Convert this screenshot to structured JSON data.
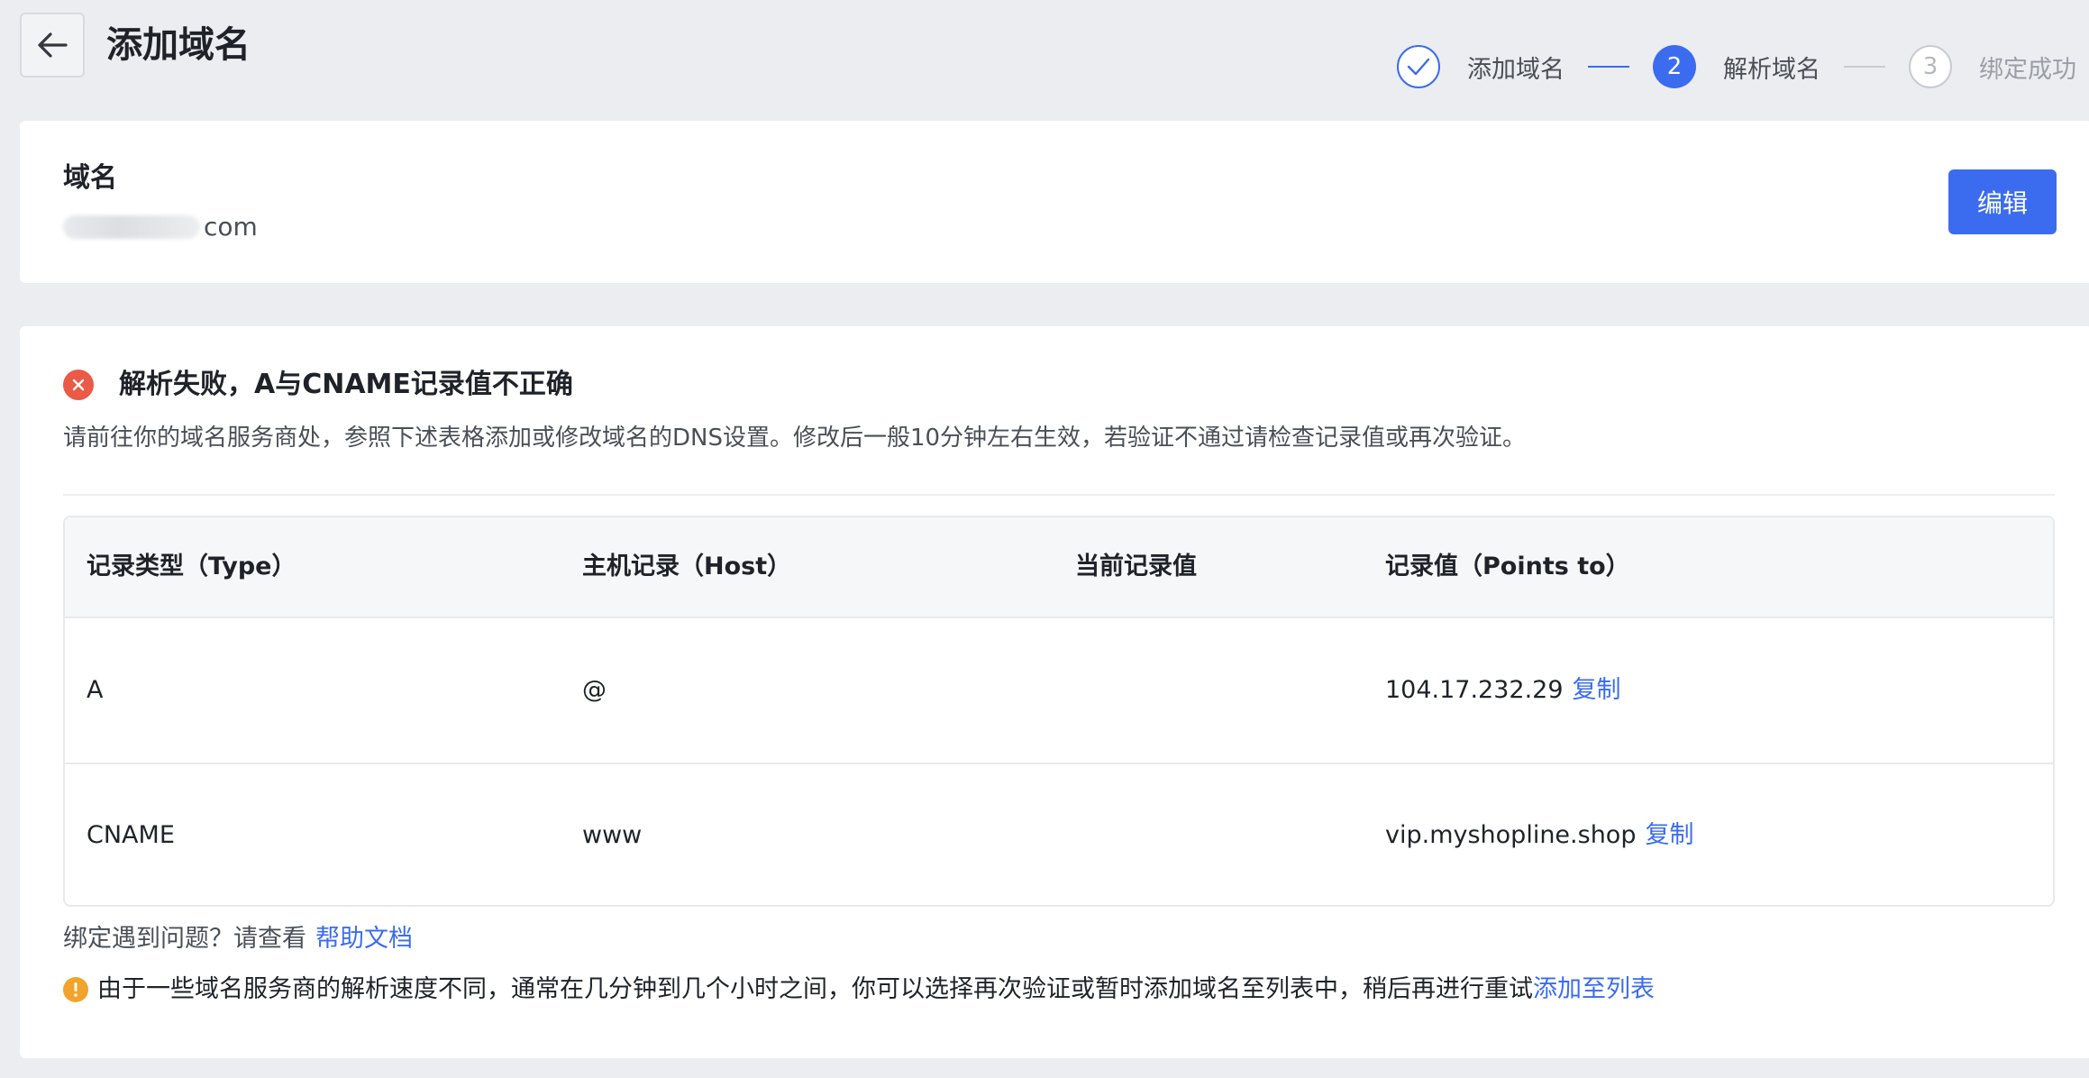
{
  "header": {
    "title": "添加域名",
    "steps": [
      {
        "label": "添加域名",
        "state": "done"
      },
      {
        "number": "2",
        "label": "解析域名",
        "state": "active"
      },
      {
        "number": "3",
        "label": "绑定成功",
        "state": "todo"
      }
    ]
  },
  "domain_card": {
    "label": "域名",
    "value_suffix": "com",
    "edit_label": "编辑"
  },
  "dns_card": {
    "error_title": "解析失败，A与CNAME记录值不正确",
    "description": "请前往你的域名服务商处，参照下述表格添加或修改域名的DNS设置。修改后一般10分钟左右生效，若验证不通过请检查记录值或再次验证。",
    "table": {
      "headers": [
        "记录类型（Type）",
        "主机记录（Host）",
        "当前记录值",
        "记录值（Points to）"
      ],
      "rows": [
        {
          "type": "A",
          "host": "@",
          "current": "",
          "points_to": "104.17.232.29",
          "copy_label": "复制"
        },
        {
          "type": "CNAME",
          "host": "www",
          "current": "",
          "points_to": "vip.myshopline.shop",
          "copy_label": "复制"
        }
      ]
    },
    "help_text": "绑定遇到问题？请查看",
    "help_link": "帮助文档",
    "warning_text": "由于一些域名服务商的解析速度不同，通常在几分钟到几个小时之间，你可以选择再次验证或暂时添加域名至列表中，稍后再进行重试",
    "warning_link": "添加至列表"
  },
  "colors": {
    "accent": "#3b6cf0",
    "error": "#ea5a47",
    "warning": "#f2a32c",
    "background": "#ecedf0"
  },
  "icons": [
    "back-arrow-icon",
    "check-icon",
    "error-circle-icon",
    "warning-circle-icon"
  ]
}
